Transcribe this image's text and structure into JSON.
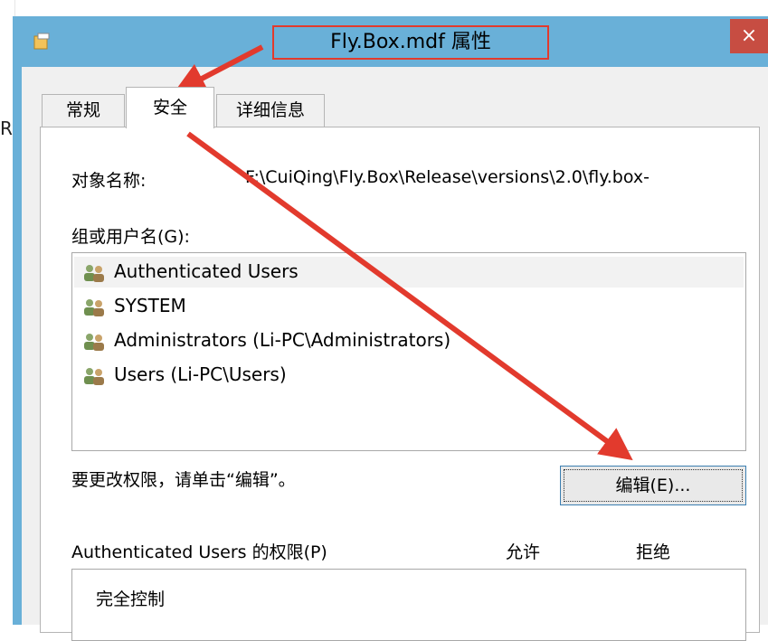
{
  "background": {
    "partial_char": "R"
  },
  "window": {
    "title": "Fly.Box.mdf 属性",
    "close_glyph": "×",
    "icon": "file-properties-icon"
  },
  "tabs": [
    {
      "label": "常规"
    },
    {
      "label": "安全",
      "active": true
    },
    {
      "label": "详细信息"
    }
  ],
  "security": {
    "object_name_label": "对象名称:",
    "object_name_value": "F:\\CuiQing\\Fly.Box\\Release\\versions\\2.0\\fly.box-",
    "group_label": "组或用户名(G):",
    "users": [
      {
        "name": "Authenticated Users",
        "icon": "user-group-icon",
        "selected": true
      },
      {
        "name": "SYSTEM",
        "icon": "user-group-icon"
      },
      {
        "name": "Administrators (Li-PC\\Administrators)",
        "icon": "user-group-icon"
      },
      {
        "name": "Users (Li-PC\\Users)",
        "icon": "user-group-icon"
      }
    ],
    "change_hint": "要更改权限，请单击“编辑”。",
    "edit_button": "编辑(E)...",
    "permissions_label": "Authenticated Users 的权限(P)",
    "allow_label": "允许",
    "deny_label": "拒绝",
    "permissions": [
      {
        "name": "完全控制"
      }
    ]
  },
  "colors": {
    "titlebar": "#69b0d8",
    "close": "#c74d42",
    "annotation": "#e23a2d"
  }
}
